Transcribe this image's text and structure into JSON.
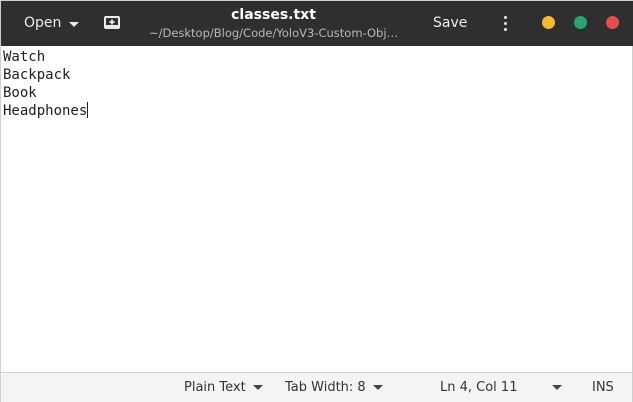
{
  "header": {
    "open_label": "Open",
    "title": "classes.txt",
    "subtitle": "~/Desktop/Blog/Code/YoloV3-Custom-Obj…",
    "save_label": "Save",
    "icons": {
      "new_tab": "new-document-icon",
      "menu": "vertical-ellipsis-icon"
    }
  },
  "editor": {
    "lines": [
      "Watch",
      "Backpack",
      "Book",
      "Headphones"
    ]
  },
  "statusbar": {
    "syntax": "Plain Text",
    "tab_width": "Tab Width: 8",
    "position": "Ln 4, Col 11",
    "mode": "INS"
  },
  "colors": {
    "headerbar": "#2f2f2f",
    "minimize": "#f2b935",
    "maximize": "#28a46f",
    "close": "#e24f4f"
  }
}
